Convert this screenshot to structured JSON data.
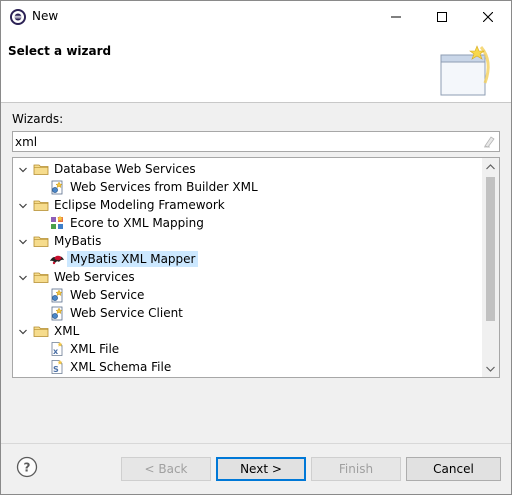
{
  "window": {
    "title": "New",
    "icon": "eclipse-icon"
  },
  "header": {
    "title": "Select a wizard",
    "banner_icon": "new-wizard-banner-icon"
  },
  "filter": {
    "label": "Wizards:",
    "value": "xml",
    "clear_icon": "clear-filter-icon"
  },
  "tree": {
    "items": [
      {
        "label": "Database Web Services",
        "level": 0,
        "type": "folder",
        "expanded": true
      },
      {
        "label": "Web Services from Builder XML",
        "level": 1,
        "type": "ws-wizard"
      },
      {
        "label": "Eclipse Modeling Framework",
        "level": 0,
        "type": "folder",
        "expanded": true
      },
      {
        "label": "Ecore to XML Mapping",
        "level": 1,
        "type": "ecore-mapping"
      },
      {
        "label": "MyBatis",
        "level": 0,
        "type": "folder",
        "expanded": true
      },
      {
        "label": "MyBatis XML Mapper",
        "level": 1,
        "type": "mybatis",
        "selected": true
      },
      {
        "label": "Web Services",
        "level": 0,
        "type": "folder",
        "expanded": true
      },
      {
        "label": "Web Service",
        "level": 1,
        "type": "ws-wizard"
      },
      {
        "label": "Web Service Client",
        "level": 1,
        "type": "ws-wizard"
      },
      {
        "label": "XML",
        "level": 0,
        "type": "folder",
        "expanded": true
      },
      {
        "label": "XML File",
        "level": 1,
        "type": "xml-file"
      },
      {
        "label": "XML Schema File",
        "level": 1,
        "type": "xml-schema"
      }
    ]
  },
  "buttons": {
    "back": "< Back",
    "next": "Next >",
    "finish": "Finish",
    "cancel": "Cancel"
  },
  "colors": {
    "selection": "#cce8ff",
    "default_button_border": "#0078d7",
    "folder": "#e8c46a"
  }
}
